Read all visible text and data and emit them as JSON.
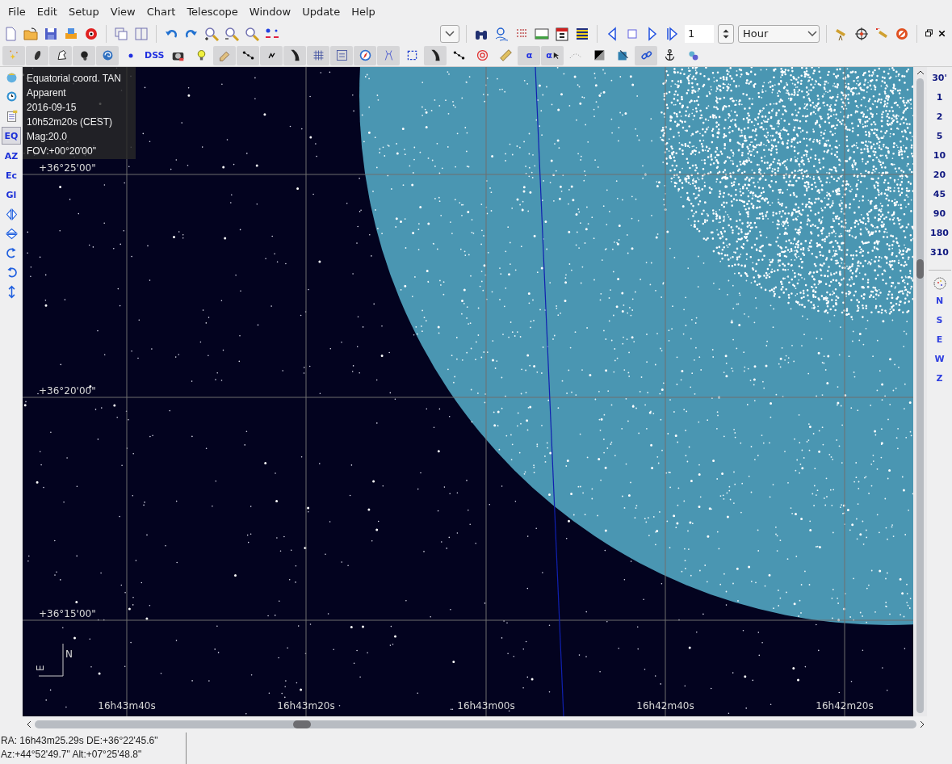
{
  "menu": [
    "File",
    "Edit",
    "Setup",
    "View",
    "Chart",
    "Telescope",
    "Window",
    "Update",
    "Help"
  ],
  "time_step": {
    "value": "1",
    "unit": "Hour"
  },
  "object_toolbar": [
    {
      "kind": "stars",
      "on": true
    },
    {
      "kind": "galaxy",
      "on": true
    },
    {
      "kind": "nebula",
      "on": true
    },
    {
      "kind": "dark-nebula",
      "on": true
    },
    {
      "kind": "swirl",
      "on": true
    },
    {
      "kind": "dot",
      "on": false
    },
    {
      "kind": "text",
      "label": "DSS",
      "on": false
    },
    {
      "kind": "camera",
      "on": false
    },
    {
      "kind": "bulb",
      "on": false
    },
    {
      "kind": "pencil",
      "on": true
    },
    {
      "kind": "dots-line",
      "on": true
    },
    {
      "kind": "small-star",
      "on": true
    },
    {
      "kind": "milky-way",
      "on": true
    },
    {
      "kind": "grid",
      "on": true
    },
    {
      "kind": "eq-grid",
      "on": true
    },
    {
      "kind": "compass",
      "on": true
    },
    {
      "kind": "constellation",
      "on": true
    },
    {
      "kind": "frame",
      "on": false
    },
    {
      "kind": "milky-way",
      "on": true
    },
    {
      "kind": "dots-line",
      "on": false
    },
    {
      "kind": "target",
      "on": false
    },
    {
      "kind": "ruler",
      "on": false
    },
    {
      "kind": "text",
      "label": "α",
      "on": true
    },
    {
      "kind": "cursor-text",
      "label": "α",
      "on": true
    },
    {
      "kind": "arc",
      "on": false
    },
    {
      "kind": "contrast",
      "on": false
    },
    {
      "kind": "square-arrow",
      "on": false
    },
    {
      "kind": "link",
      "on": true
    },
    {
      "kind": "anchor",
      "on": false
    },
    {
      "kind": "circles",
      "on": false
    }
  ],
  "left_tools": [
    {
      "kind": "globe",
      "selected": false
    },
    {
      "kind": "clock",
      "selected": false
    },
    {
      "kind": "notes",
      "selected": false
    },
    {
      "kind": "text",
      "label": "EQ",
      "selected": true
    },
    {
      "kind": "text",
      "label": "AZ",
      "selected": false
    },
    {
      "kind": "text",
      "label": "Ec",
      "selected": false
    },
    {
      "kind": "text",
      "label": "Gl",
      "selected": false
    },
    {
      "kind": "flip-h",
      "selected": false
    },
    {
      "kind": "flip-v",
      "selected": false
    },
    {
      "kind": "rotate-cw",
      "selected": false
    },
    {
      "kind": "rotate-ccw",
      "selected": false
    },
    {
      "kind": "updown",
      "selected": false
    }
  ],
  "chart": {
    "info": [
      "Equatorial coord. TAN",
      "Apparent",
      "2016-09-15",
      "10h52m20s (CEST)",
      "Mag:20.0",
      "FOV:+00°20'00\""
    ],
    "dec_labels": [
      "+36°25'00\"",
      "+36°20'00\"",
      "+36°15'00\""
    ],
    "ra_labels": [
      "16h43m40s",
      "16h43m20s",
      "16h43m00s",
      "16h42m40s",
      "16h42m20s"
    ],
    "compass": {
      "north": "N",
      "east": "E"
    }
  },
  "fov_buttons": [
    "30'",
    "1",
    "2",
    "5",
    "10",
    "20",
    "45",
    "90",
    "180",
    "310"
  ],
  "orientation_buttons": [
    "N",
    "S",
    "E",
    "W",
    "Z"
  ],
  "status": {
    "line_1": "RA: 16h43m25.29s DE:+36°22'45.6\"",
    "line_2": "Az:+44°52'49.7\" Alt:+07°25'48.8\""
  }
}
